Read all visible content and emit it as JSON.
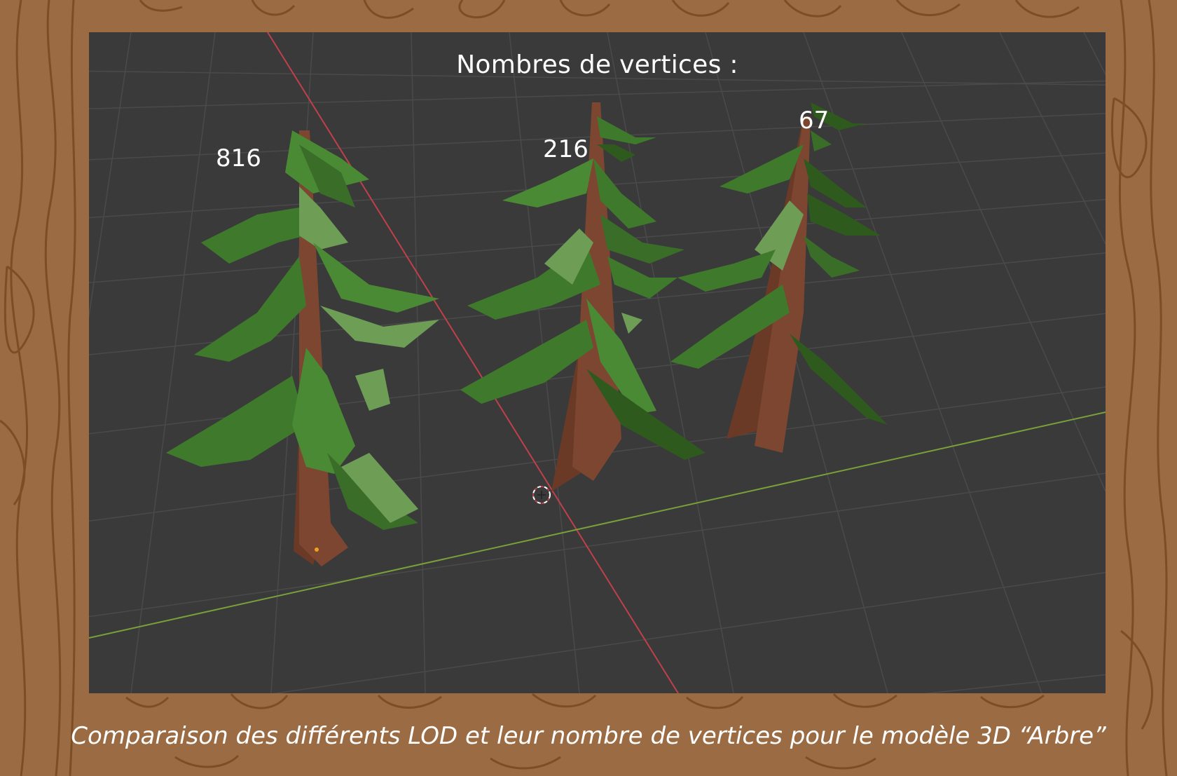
{
  "viewport": {
    "title": "Nombres de vertices :",
    "models": [
      {
        "label": "816"
      },
      {
        "label": "216"
      },
      {
        "label": "67"
      }
    ]
  },
  "caption": "Comparaison des différents LOD et leur nombre de vertices pour le modèle 3D “Arbre”",
  "colors": {
    "wood_background": "#9b6b43",
    "wood_grain": "#7a4a22",
    "viewport_background": "#3a3a3a",
    "grid_line": "#4a4a4a",
    "x_axis": "#c0404a",
    "y_axis": "#7aa03a",
    "trunk": "#6b3a26",
    "foliage": "#3f7a2c",
    "foliage_light": "#6e9e55",
    "foliage_dark": "#2e5a1e",
    "text": "#ffffff"
  },
  "icons": [
    "3d-cursor-icon",
    "origin-dot-icon"
  ]
}
